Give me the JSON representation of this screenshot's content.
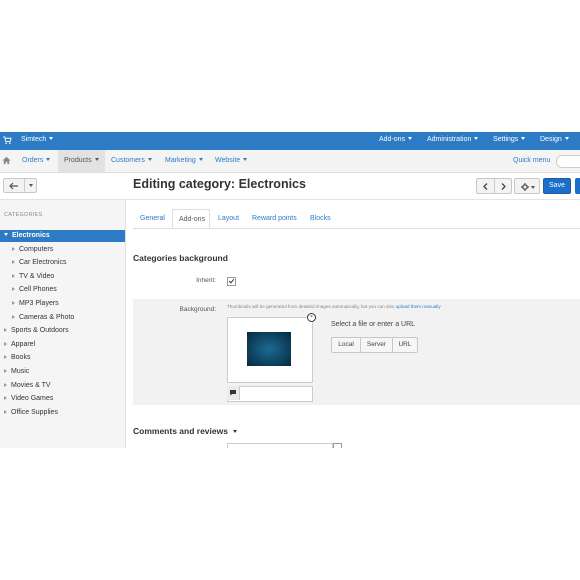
{
  "topbar": {
    "brand": "Simtech",
    "nav": [
      "Add-ons",
      "Administration",
      "Settings",
      "Design"
    ]
  },
  "subnav": {
    "items": [
      "Orders",
      "Products",
      "Customers",
      "Marketing",
      "Website"
    ],
    "active": "Products",
    "quick_menu": "Quick menu"
  },
  "page": {
    "title": "Editing category: Electronics",
    "save_label": "Save"
  },
  "sidebar": {
    "heading": "CATEGORIES",
    "items": [
      {
        "label": "Electronics",
        "level": 0,
        "active": true
      },
      {
        "label": "Computers",
        "level": 1
      },
      {
        "label": "Car Electronics",
        "level": 1
      },
      {
        "label": "TV & Video",
        "level": 1
      },
      {
        "label": "Cell Phones",
        "level": 1
      },
      {
        "label": "MP3 Players",
        "level": 1
      },
      {
        "label": "Cameras & Photo",
        "level": 1
      },
      {
        "label": "Sports & Outdoors",
        "level": 0
      },
      {
        "label": "Apparel",
        "level": 0
      },
      {
        "label": "Books",
        "level": 0
      },
      {
        "label": "Music",
        "level": 0
      },
      {
        "label": "Movies & TV",
        "level": 0
      },
      {
        "label": "Video Games",
        "level": 0
      },
      {
        "label": "Office Supplies",
        "level": 0
      }
    ]
  },
  "tabs": [
    "General",
    "Add-ons",
    "Layout",
    "Reward points",
    "Blocks"
  ],
  "active_tab": "Add-ons",
  "categories_background": {
    "title": "Categories background",
    "inherit_label": "Inherit:",
    "inherit_checked": true,
    "background_label": "Background:",
    "hint": "Thumbnails will be generated from detailed images automatically, but you can also",
    "hint_link": "upload them manually",
    "picker_title": "Select a file or enter a URL",
    "buttons": [
      "Local",
      "Server",
      "URL"
    ]
  },
  "comments": {
    "title": "Comments and reviews"
  },
  "colors": {
    "topbar": "#2d7bc4",
    "accent": "#2d7bc4",
    "save": "#1b6fc8"
  }
}
